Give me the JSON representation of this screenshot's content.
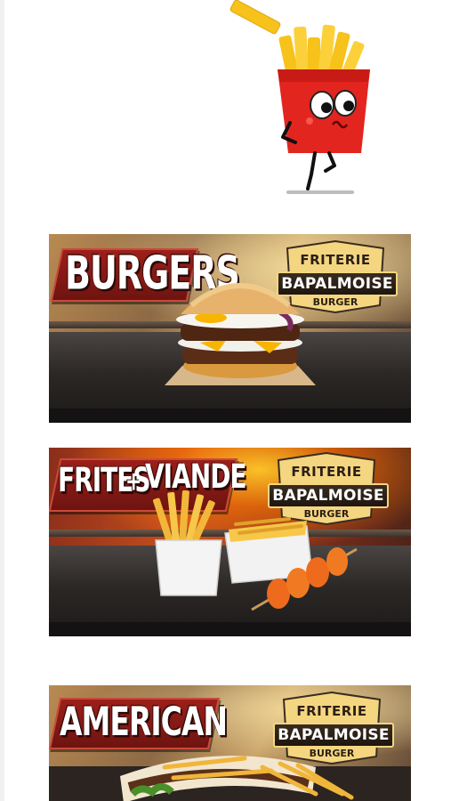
{
  "mascot": {
    "icon": "fries-mascot-icon"
  },
  "banners": [
    {
      "title": "BURGERS",
      "logo": {
        "top": "FRITERIE",
        "middle": "BAPALMOISE",
        "bottom": "BURGER"
      },
      "food_icon": "burger-icon"
    },
    {
      "title_left": "FRITES",
      "title_plus": "+",
      "title_right": "VIANDE",
      "logo": {
        "top": "FRITERIE",
        "middle": "BAPALMOISE",
        "bottom": "BURGER"
      },
      "food_icon": "fries-and-skewer-icon"
    },
    {
      "title": "AMERICAN",
      "logo": {
        "top": "FRITERIE",
        "middle": "BAPALMOISE",
        "bottom": "BURGER"
      },
      "food_icon": "american-sandwich-icon"
    }
  ],
  "colors": {
    "brand_red": "#9c1f1a",
    "fries_yellow": "#f7c21a",
    "logo_gold": "#f5d680"
  }
}
